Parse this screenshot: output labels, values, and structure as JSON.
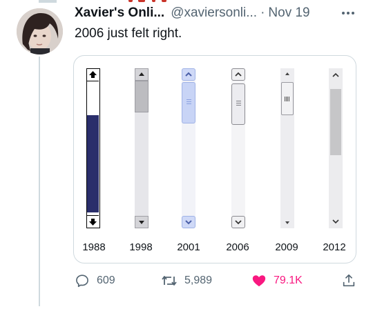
{
  "tweet": {
    "display_name": "Xavier's Onli...",
    "handle": "@xaviersonli...",
    "separator": "·",
    "date": "Nov 19",
    "text": "2006 just felt right."
  },
  "scrollbars": [
    {
      "year": "1988",
      "style": "classic-mac"
    },
    {
      "year": "1998",
      "style": "windows-98"
    },
    {
      "year": "2001",
      "style": "windows-xp"
    },
    {
      "year": "2006",
      "style": "windows-vista"
    },
    {
      "year": "2009",
      "style": "windows-7"
    },
    {
      "year": "2012",
      "style": "windows-8"
    }
  ],
  "actions": {
    "replies": "609",
    "retweets": "5,989",
    "likes": "79.1K"
  },
  "icons": [
    "more-icon",
    "reply-icon",
    "retweet-icon",
    "like-icon",
    "share-icon"
  ],
  "colors": {
    "text": "#0f1419",
    "secondary": "#536471",
    "border": "#cfd9de",
    "like": "#f91880",
    "classic_thumb": "#2a2e6b"
  }
}
